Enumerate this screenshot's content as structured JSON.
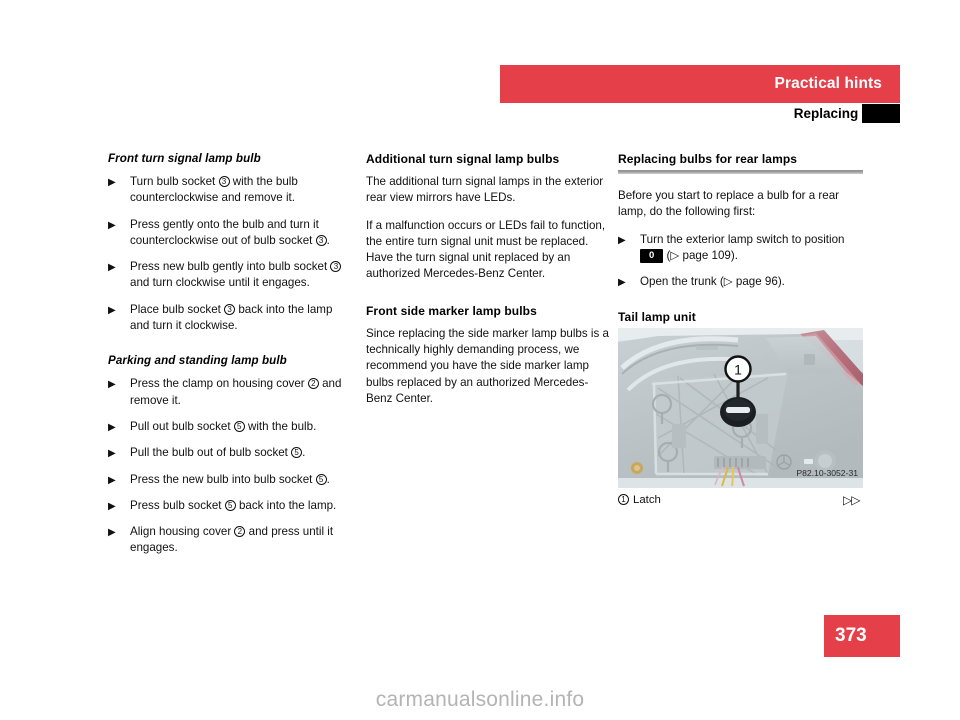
{
  "header": {
    "section_title": "Practical hints",
    "topic_title": "Replacing bulbs"
  },
  "column_1": {
    "heading_1": "Front turn signal lamp bulb",
    "steps_1": [
      {
        "pre": "Turn bulb socket ",
        "ref": "3",
        "post": " with the bulb counterclockwise and remove it."
      },
      {
        "pre": "Press gently onto the bulb and turn it counterclockwise out of bulb socket ",
        "ref": "3",
        "post": "."
      },
      {
        "pre": "Press new bulb gently into bulb socket ",
        "ref": "3",
        "post": " and turn clockwise until it engages."
      },
      {
        "pre": "Place bulb socket ",
        "ref": "3",
        "post": " back into the lamp and turn it clockwise."
      }
    ],
    "heading_2": "Parking and standing lamp bulb",
    "steps_2": [
      {
        "pre": "Press the clamp on housing cover ",
        "ref": "2",
        "post": " and remove it."
      },
      {
        "pre": "Pull out bulb socket ",
        "ref": "5",
        "post": " with the bulb."
      },
      {
        "pre": "Pull the bulb out of bulb socket ",
        "ref": "5",
        "post": "."
      },
      {
        "pre": "Press the new bulb into bulb socket ",
        "ref": "5",
        "post": "."
      },
      {
        "pre": "Press bulb socket ",
        "ref": "5",
        "post": " back into the lamp."
      },
      {
        "pre": "Align housing cover ",
        "ref": "2",
        "post": " and press until it engages."
      }
    ]
  },
  "column_2": {
    "heading_1": "Additional turn signal lamp bulbs",
    "paragraph_1": "The additional turn signal lamps in the exterior rear view mirrors have LEDs.",
    "paragraph_2": "If a malfunction occurs or LEDs fail to function, the entire turn signal unit must be replaced. Have the turn signal unit replaced by an authorized Mercedes-Benz Center.",
    "heading_2": "Front side marker lamp bulbs",
    "paragraph_3": "Since replacing the side marker lamp bulbs is a technically highly demanding process, we recommend you have the side marker lamp bulbs replaced by an authorized Mercedes-Benz Center."
  },
  "column_3": {
    "heading_1": "Replacing bulbs for rear lamps",
    "paragraph_1": "Before you start to replace a bulb for a rear lamp, do the following first:",
    "step_1_pre": "Turn the exterior lamp switch to position ",
    "step_1_badge": "0",
    "step_1_post": " (▷ page 109).",
    "step_2": "Open the trunk (▷ page 96).",
    "heading_2": "Tail lamp unit",
    "figure_code": "P82.10-3052-31",
    "figure_callout": "1",
    "figure_caption_ref": "1",
    "figure_caption_text": "Latch",
    "continuation_marker": "▷▷"
  },
  "footer": {
    "page_number": "373",
    "watermark": "carmanualsonline.info"
  },
  "colors": {
    "accent_red": "#e5404a",
    "rule_gray": "#8d8d8d",
    "watermark_gray": "#b4b4b4",
    "illustration_base": "#c7cdd0"
  }
}
